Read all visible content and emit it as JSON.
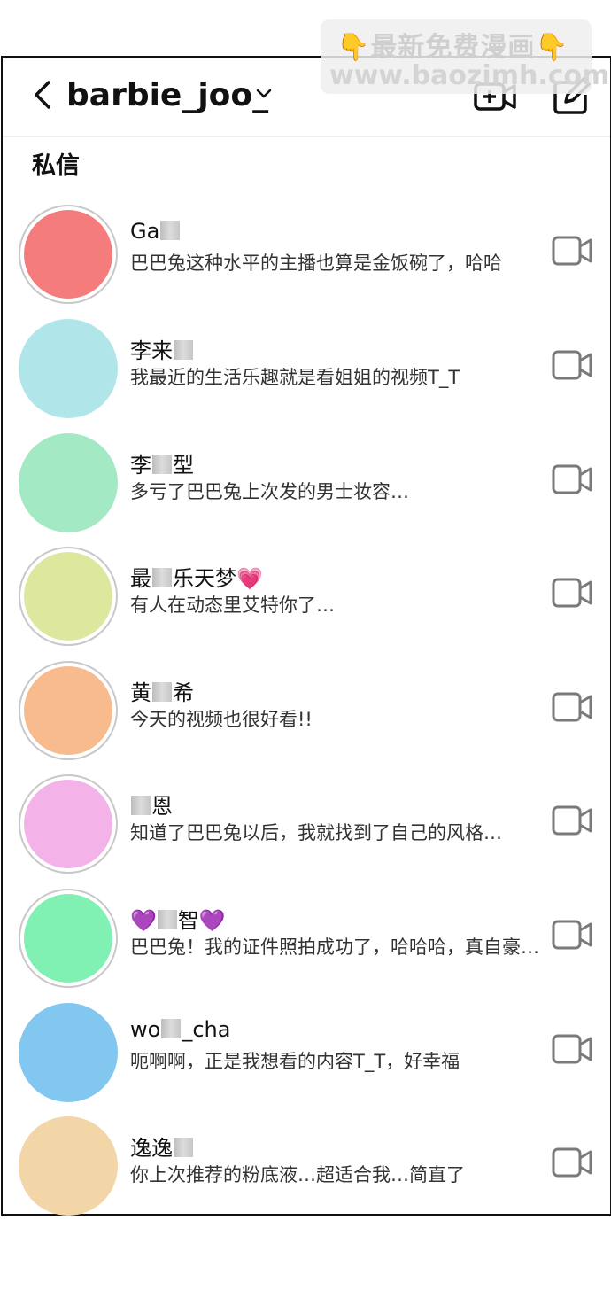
{
  "watermark": {
    "line1": "最新免费漫画",
    "line2": "www.baozimh.com",
    "hand_glyph": "👇"
  },
  "header": {
    "title": "barbie_joo_",
    "back_icon": "chevron-left-icon",
    "dropdown_icon": "chevron-down-icon",
    "new_video_icon": "video-plus-icon",
    "edit_icon": "edit-icon"
  },
  "section_title": "私信",
  "colors": {
    "border": "#111111",
    "divider": "#ececec",
    "icon_gray": "#7a7a7a"
  },
  "conversations": [
    {
      "name_a": "Ga",
      "name_b": "",
      "name_c": "",
      "message": "巴巴兔这种水平的主播也算是金饭碗了，哈哈",
      "avatar_color": "#f47c7c",
      "ring": true
    },
    {
      "name_a": "李来",
      "name_b": "",
      "name_c": "",
      "message": "我最近的生活乐趣就是看姐姐的视频T_T",
      "avatar_color": "#b0e6ea",
      "ring": false
    },
    {
      "name_a": "李",
      "name_b": "型",
      "name_c": "",
      "message": "多亏了巴巴兔上次发的男士妆容…",
      "avatar_color": "#a3e9c4",
      "ring": false
    },
    {
      "name_a": "最",
      "name_b": "乐天梦",
      "name_c": "💗",
      "message": "有人在动态里艾特你了…",
      "avatar_color": "#dde89e",
      "ring": true
    },
    {
      "name_a": "黄",
      "name_b": "希",
      "name_c": "",
      "message": "今天的视频也很好看!!",
      "avatar_color": "#f7bb8e",
      "ring": true
    },
    {
      "name_a": "",
      "name_b": "恩",
      "name_c": "",
      "message": "知道了巴巴兔以后，我就找到了自己的风格…",
      "avatar_color": "#f4b3e8",
      "ring": true
    },
    {
      "name_a": "💜",
      "name_b": "智",
      "name_c": "💜",
      "message": "巴巴兔！我的证件照拍成功了，哈哈哈，真自豪…",
      "avatar_color": "#81f0b3",
      "ring": true
    },
    {
      "name_a": "wo",
      "name_b": "_cha",
      "name_c": "",
      "message": "呃啊啊，正是我想看的内容T_T，好幸福",
      "avatar_color": "#82c7ef",
      "ring": false
    },
    {
      "name_a": "逸逸",
      "name_b": "",
      "name_c": "",
      "message": "你上次推荐的粉底液…超适合我…简直了",
      "avatar_color": "#f3d6a8",
      "ring": false
    }
  ]
}
